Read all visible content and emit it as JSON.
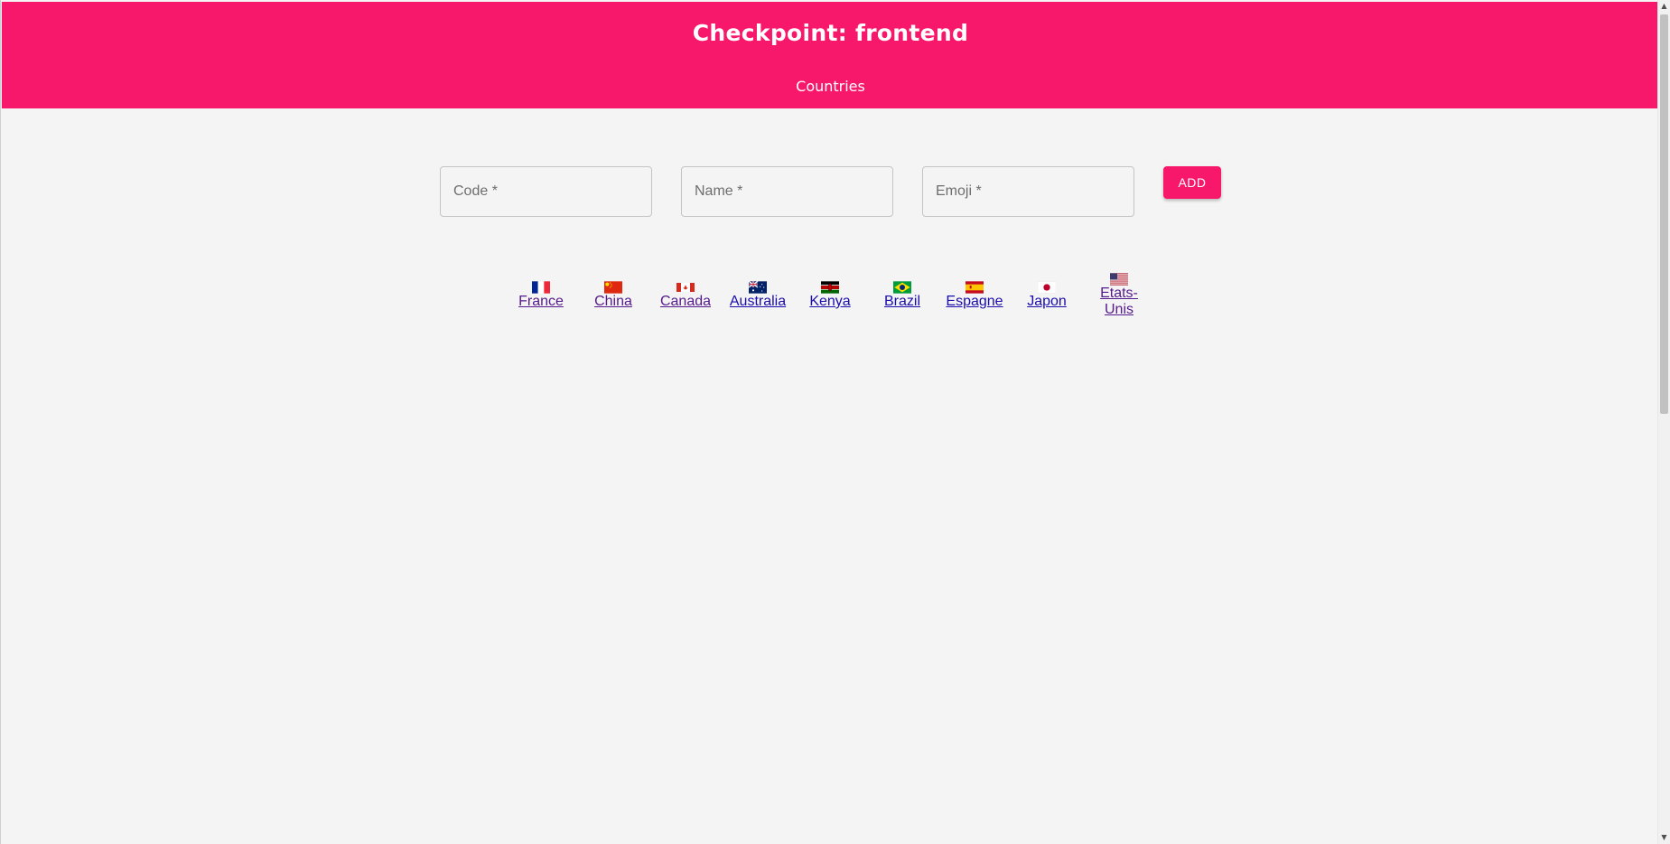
{
  "header": {
    "title": "Checkpoint: frontend",
    "nav_link": "Countries",
    "background": "#f8186b"
  },
  "form": {
    "code_placeholder": "Code *",
    "name_placeholder": "Name *",
    "emoji_placeholder": "Emoji *",
    "add_label": "ADD"
  },
  "countries": [
    {
      "name": "France",
      "flag": "flag-fr-icon"
    },
    {
      "name": "China",
      "flag": "flag-cn-icon"
    },
    {
      "name": "Canada",
      "flag": "flag-ca-icon"
    },
    {
      "name": "Australia",
      "flag": "flag-au-icon"
    },
    {
      "name": "Kenya",
      "flag": "flag-ke-icon"
    },
    {
      "name": "Brazil",
      "flag": "flag-br-icon"
    },
    {
      "name": "Espagne",
      "flag": "flag-es-icon"
    },
    {
      "name": "Japon",
      "flag": "flag-jp-icon"
    },
    {
      "name": "Etats-Unis",
      "flag": "flag-us-icon"
    }
  ]
}
